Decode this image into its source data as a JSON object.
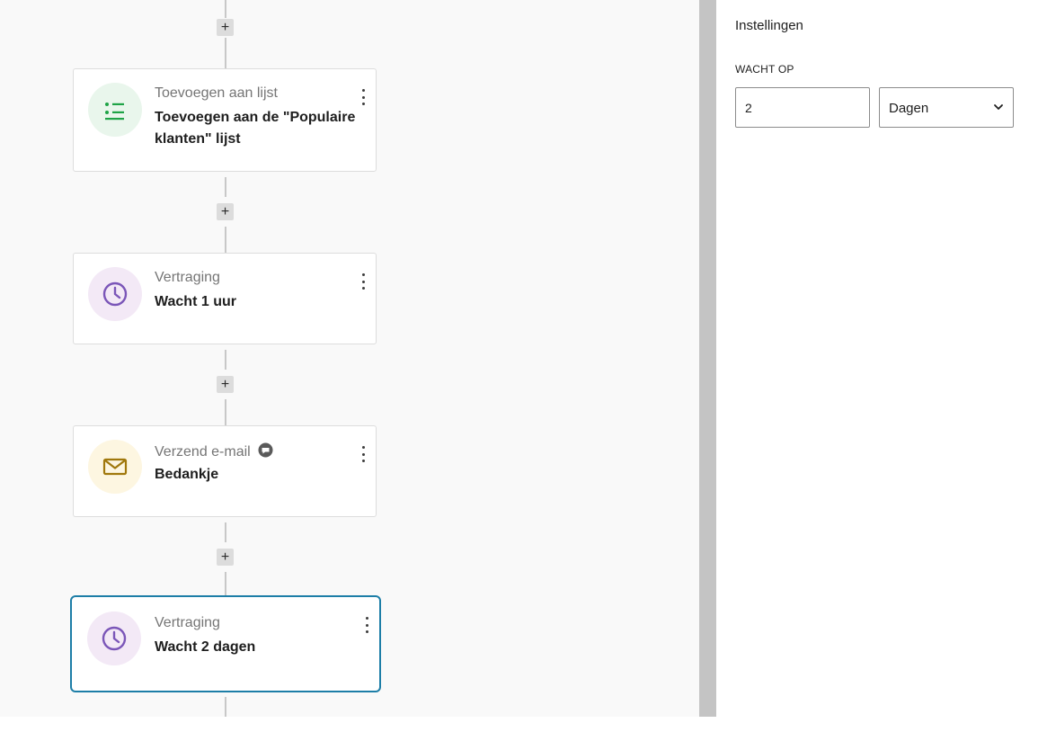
{
  "sidebar": {
    "title": "Instellingen",
    "wait_label": "WACHT OP",
    "wait_value": "2",
    "unit": "Dagen"
  },
  "steps": [
    {
      "label": "Toevoegen aan lijst",
      "title": "Toevoegen aan de \"Populaire klanten\" lijst",
      "icon": "list-icon",
      "accent": "#1ea346",
      "bg": "#e9f6ec"
    },
    {
      "label": "Vertraging",
      "title": "Wacht 1 uur",
      "icon": "clock-icon",
      "accent": "#7b56b8",
      "bg": "#f3e9f6"
    },
    {
      "label": "Verzend e-mail",
      "title": "Bedankje",
      "icon": "envelope-icon",
      "accent": "#a0780c",
      "bg": "#fdf6e1"
    },
    {
      "label": "Vertraging",
      "title": "Wacht 2 dagen",
      "icon": "clock-icon",
      "accent": "#7b56b8",
      "bg": "#f3e9f6",
      "selected": true
    }
  ],
  "add_step_label": "+"
}
